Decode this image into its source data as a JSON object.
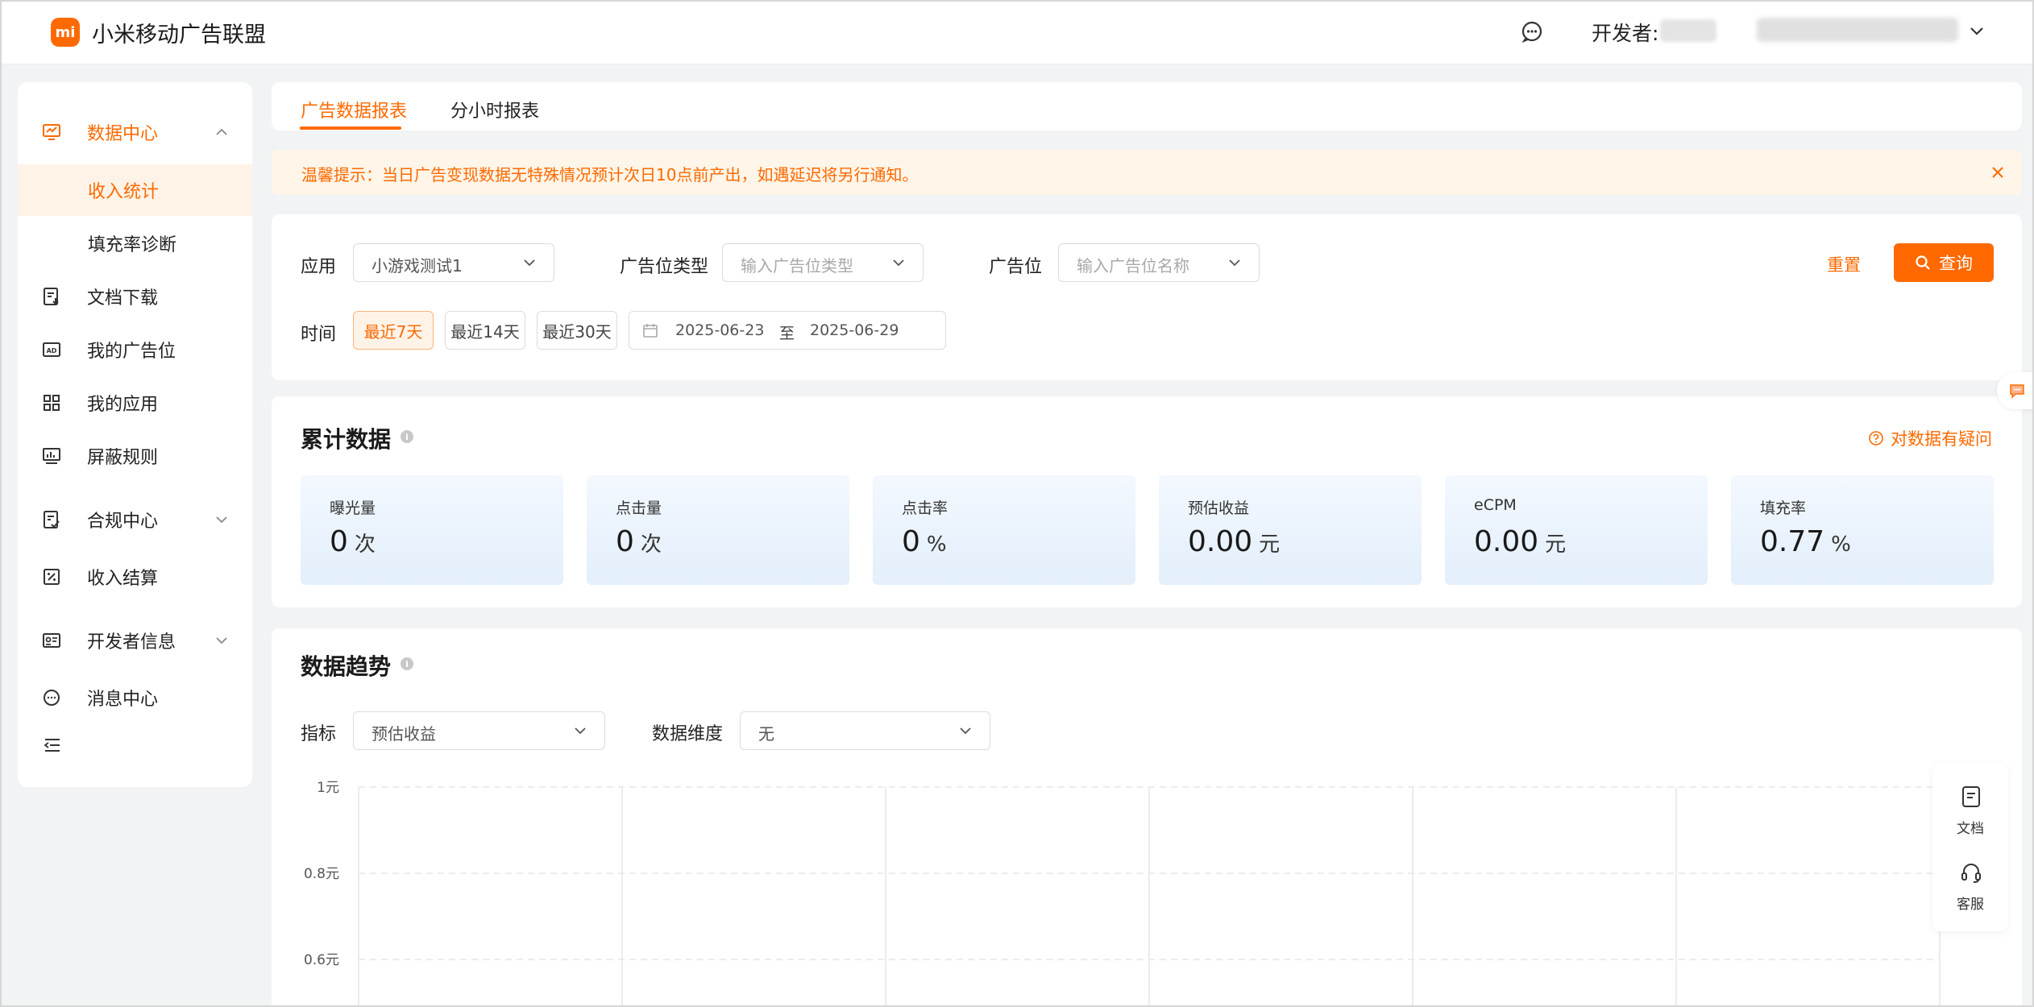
{
  "header": {
    "logo_text": "mi",
    "brand": "小米移动广告联盟",
    "developer_label": "开发者:"
  },
  "sidebar": {
    "items": [
      {
        "label": "数据中心",
        "icon": "monitor-chart-icon"
      },
      {
        "label": "收入统计"
      },
      {
        "label": "填充率诊断"
      },
      {
        "label": "文档下载",
        "icon": "document-download-icon"
      },
      {
        "label": "我的广告位",
        "icon": "ad-icon"
      },
      {
        "label": "我的应用",
        "icon": "grid-apps-icon"
      },
      {
        "label": "屏蔽规则",
        "icon": "chart-board-icon"
      },
      {
        "label": "合规中心",
        "icon": "checklist-icon"
      },
      {
        "label": "收入结算",
        "icon": "percent-icon"
      },
      {
        "label": "开发者信息",
        "icon": "id-card-icon"
      },
      {
        "label": "消息中心",
        "icon": "chat-bubble-icon"
      }
    ]
  },
  "tabs": [
    {
      "label": "广告数据报表",
      "active": true
    },
    {
      "label": "分小时报表",
      "active": false
    }
  ],
  "notice": {
    "text": "温馨提示：当日广告变现数据无特殊情况预计次日10点前产出，如遇延迟将另行通知。"
  },
  "filters": {
    "app_label": "应用",
    "app_value": "小游戏测试1",
    "ad_type_label": "广告位类型",
    "ad_type_placeholder": "输入广告位类型",
    "ad_slot_label": "广告位",
    "ad_slot_placeholder": "输入广告位名称",
    "reset_label": "重置",
    "query_label": "查询",
    "time_label": "时间",
    "ranges": [
      {
        "label": "最近7天",
        "active": true
      },
      {
        "label": "最近14天",
        "active": false
      },
      {
        "label": "最近30天",
        "active": false
      }
    ],
    "date_start": "2025-06-23",
    "date_sep": "至",
    "date_end": "2025-06-29"
  },
  "summary": {
    "title": "累计数据",
    "question_link": "对数据有疑问",
    "metrics": [
      {
        "label": "曝光量",
        "value": "0",
        "unit": "次"
      },
      {
        "label": "点击量",
        "value": "0",
        "unit": "次"
      },
      {
        "label": "点击率",
        "value": "0",
        "unit": "%"
      },
      {
        "label": "预估收益",
        "value": "0.00",
        "unit": "元"
      },
      {
        "label": "eCPM",
        "value": "0.00",
        "unit": "元"
      },
      {
        "label": "填充率",
        "value": "0.77",
        "unit": "%"
      }
    ]
  },
  "trend": {
    "title": "数据趋势",
    "metric_label": "指标",
    "metric_value": "预估收益",
    "dimension_label": "数据维度",
    "dimension_value": "无"
  },
  "chart_data": {
    "type": "line",
    "title": "",
    "xlabel": "",
    "ylabel": "",
    "y_ticks": [
      "1元",
      "0.8元",
      "0.6元"
    ],
    "y_tick_values": [
      1,
      0.8,
      0.6
    ],
    "ylim_visible": [
      0.6,
      1
    ],
    "vertical_grid_count": 7,
    "grid": true
  },
  "float_panel": {
    "doc_label": "文档",
    "service_label": "客服"
  },
  "colors": {
    "accent": "#ff6900",
    "notice_bg": "#fff5e8",
    "metric_bg": "#eaf3fc"
  }
}
